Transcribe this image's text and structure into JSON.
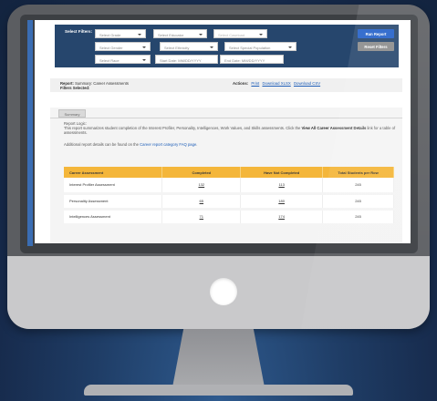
{
  "filters": {
    "label": "Select Filters:",
    "row1": [
      "Select Grade",
      "Select Educator",
      "Select Caseload"
    ],
    "row2": [
      "Select Gender",
      "Select Ethnicity",
      "Select Special Population"
    ],
    "row3": [
      "Select Race"
    ],
    "start_date_placeholder": "Start Date: MM/DD/YYYY",
    "end_date_placeholder": "End Date: MM/DD/YYYY",
    "run_label": "Run Report",
    "reset_label": "Reset Filters"
  },
  "report": {
    "report_label": "Report:",
    "report_value": "Summary: Career Assessments",
    "filters_selected_label": "Filters Selected:",
    "actions_label": "Actions:",
    "actions": [
      "Print",
      "Download XLSX",
      "Download CSV"
    ]
  },
  "summary": {
    "tab_label": "Summary",
    "logic_heading": "Report Logic:",
    "logic_text": "This report summarizes student completion of the Interest Profiler, Personality, Intelligences, Work Values, and Skills assessments. Click the ",
    "logic_link": "View All Career Assessment Details",
    "logic_text_end": " link for a table of assessments.",
    "additional_text": "Additional report details can be found on the ",
    "faq_link": "Career report category FAQ page",
    "additional_end": "."
  },
  "table": {
    "headers": [
      "Career Assessment",
      "Completed",
      "Have Not Completed",
      "Total Students per Row"
    ],
    "rows": [
      [
        "Interest Profiler Assessment",
        "132",
        "113",
        "245"
      ],
      [
        "Personality Assessment",
        "65",
        "180",
        "245"
      ],
      [
        "Intelligences Assessment",
        "71",
        "174",
        "245"
      ]
    ]
  }
}
